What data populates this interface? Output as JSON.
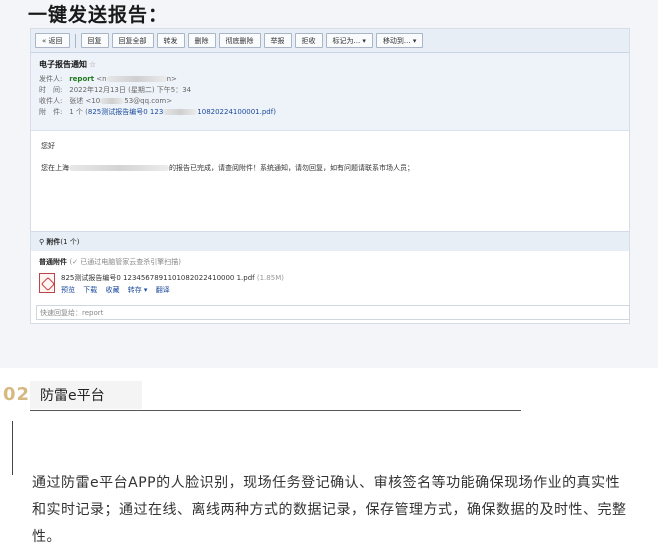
{
  "heading": "一键发送报告：",
  "toolbar": [
    "« 返回",
    "回复",
    "回复全部",
    "转发",
    "删除",
    "彻底删除",
    "举报",
    "拒收",
    "标记为... ▾",
    "移动到... ▾"
  ],
  "email": {
    "subject": "电子报告通知",
    "star": "☆",
    "from_label": "发件人:",
    "from_name": "report",
    "from_addr_prefix": "<n",
    "from_addr_suffix": "n>",
    "time_label": "时　间:",
    "time_value": "2022年12月13日 (星期二) 下午5：34",
    "to_label": "收件人:",
    "to_value": "张述 <10",
    "to_value_suffix": "53@qq.com>",
    "attach_label": "附　件:",
    "attach_count": "1 个 (",
    "attach_link": "825测试报告编号0 123",
    "attach_link_suffix": "10820224100001.pdf)",
    "greeting": "您好",
    "body_prefix": "您在上海",
    "body_suffix": "的报告已完成，请查阅附件！系统通知，请勿回复，如有问题请联系市场人员；"
  },
  "attachments": {
    "bar_label": "附件",
    "bar_count": "(1 个)",
    "ordinary_title": "普通附件",
    "scan_note": "(✓ 已通过电脑管家云查杀引擎扫描)",
    "file_name": "825测试报告编号0 1234567891101082022410000 1.pdf",
    "file_size": "(1.85M)",
    "actions": [
      "预览",
      "下载",
      "收藏",
      "转存 ▾",
      "翻译"
    ]
  },
  "quick_reply_placeholder": "快速回复给：report",
  "section": {
    "number": "02",
    "title": "防雷e平台",
    "paragraph": "通过防雷e平台APP的人脸识别，现场任务登记确认、审核签名等功能确保现场作业的真实性和实时记录；通过在线、离线两种方式的数据记录，保存管理方式，确保数据的及时性、完整性。"
  }
}
